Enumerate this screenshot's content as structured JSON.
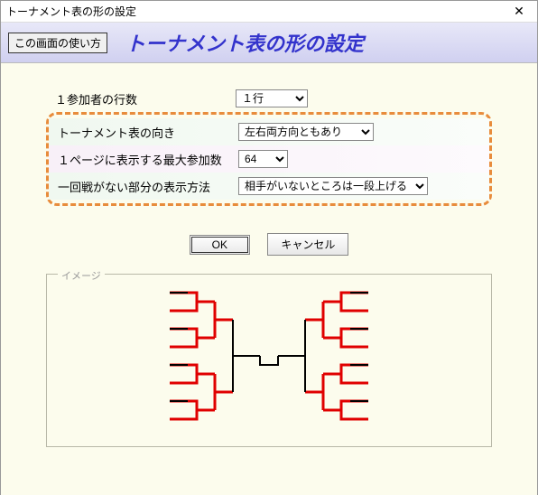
{
  "window": {
    "title": "トーナメント表の形の設定"
  },
  "header": {
    "help_button": "この画面の使い方",
    "main_title": "トーナメント表の形の設定"
  },
  "rows": {
    "participant_lines": {
      "label": "１参加者の行数",
      "value": "１行"
    },
    "orientation": {
      "label": "トーナメント表の向き",
      "value": "左右両方向ともあり"
    },
    "max_participants": {
      "label": "１ページに表示する最大参加数",
      "value": "64"
    },
    "bye_display": {
      "label": "一回戦がない部分の表示方法",
      "value": "相手がいないところは一段上げる"
    }
  },
  "buttons": {
    "ok": "OK",
    "cancel": "キャンセル"
  },
  "image_label": "イメージ"
}
